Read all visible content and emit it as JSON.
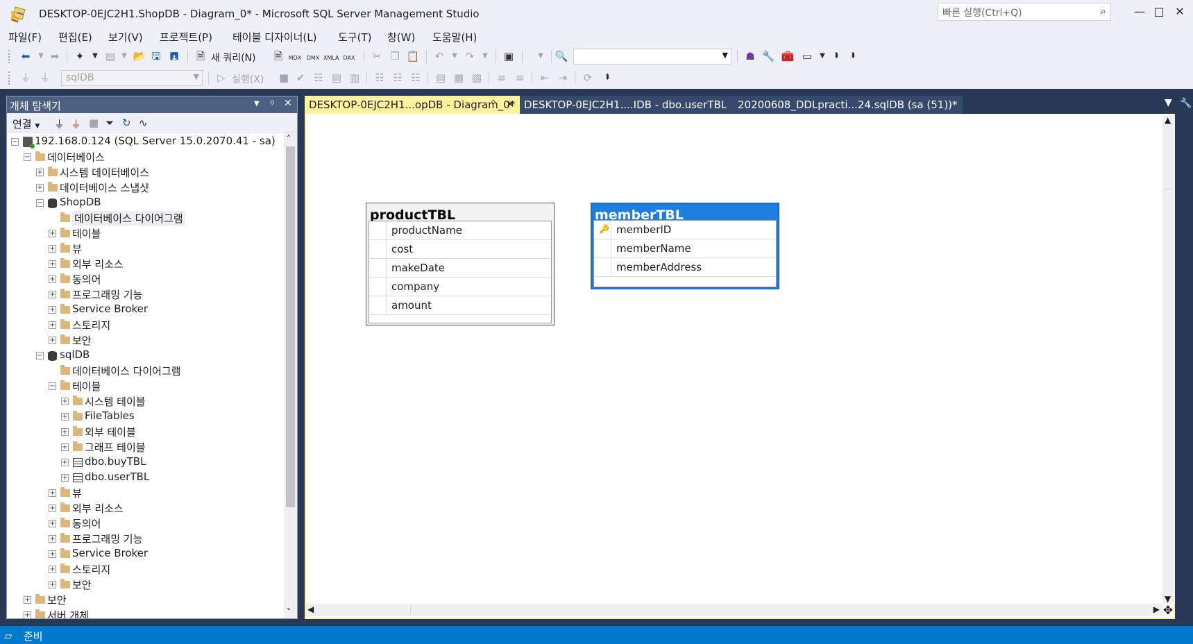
{
  "window": {
    "title": "DESKTOP-0EJC2H1.ShopDB - Diagram_0* - Microsoft SQL Server Management Studio",
    "quick_launch_placeholder": "빠른 실행(Ctrl+Q)",
    "minimize": "—",
    "maximize": "□",
    "close": "✕"
  },
  "menu": [
    "파일(F)",
    "편집(E)",
    "보기(V)",
    "프로젝트(P)",
    "테이블 디자이너(L)",
    "도구(T)",
    "창(W)",
    "도움말(H)"
  ],
  "toolbar1": {
    "new_query_label": "새 쿼리(N)",
    "query_types": [
      "MDX",
      "DMX",
      "XMLA",
      "DAX"
    ]
  },
  "toolbar2": {
    "database_combo": "sqlDB",
    "execute_label": "실행(X)"
  },
  "object_explorer": {
    "title": "개체 탐색기",
    "connect_label": "연결",
    "pin": "ᛜ",
    "close": "✕",
    "dropdown": "▼",
    "tree": [
      {
        "label": "192.168.0.124 (SQL Server 15.0.2070.41 - sa)",
        "icon": "server-icon",
        "level": 0,
        "expander": "−"
      },
      {
        "label": "데이터베이스",
        "icon": "folder-icon",
        "level": 1,
        "expander": "−"
      },
      {
        "label": "시스템 데이터베이스",
        "icon": "folder-icon",
        "level": 2,
        "expander": "+"
      },
      {
        "label": "데이터베이스 스냅샷",
        "icon": "folder-icon",
        "level": 2,
        "expander": "+"
      },
      {
        "label": "ShopDB",
        "icon": "database-icon",
        "level": 2,
        "expander": "−"
      },
      {
        "label": "데이터베이스 다이어그램",
        "icon": "folder-icon",
        "level": 3,
        "expander": "",
        "selected": true
      },
      {
        "label": "테이블",
        "icon": "folder-icon",
        "level": 3,
        "expander": "+"
      },
      {
        "label": "뷰",
        "icon": "folder-icon",
        "level": 3,
        "expander": "+"
      },
      {
        "label": "외부 리소스",
        "icon": "folder-icon",
        "level": 3,
        "expander": "+"
      },
      {
        "label": "동의어",
        "icon": "folder-icon",
        "level": 3,
        "expander": "+"
      },
      {
        "label": "프로그래밍 기능",
        "icon": "folder-icon",
        "level": 3,
        "expander": "+"
      },
      {
        "label": "Service Broker",
        "icon": "folder-icon",
        "level": 3,
        "expander": "+"
      },
      {
        "label": "스토리지",
        "icon": "folder-icon",
        "level": 3,
        "expander": "+"
      },
      {
        "label": "보안",
        "icon": "folder-icon",
        "level": 3,
        "expander": "+"
      },
      {
        "label": "sqlDB",
        "icon": "database-icon",
        "level": 2,
        "expander": "−"
      },
      {
        "label": "데이터베이스 다이어그램",
        "icon": "folder-icon",
        "level": 3,
        "expander": ""
      },
      {
        "label": "테이블",
        "icon": "folder-icon",
        "level": 3,
        "expander": "−"
      },
      {
        "label": "시스템 테이블",
        "icon": "folder-icon",
        "level": 4,
        "expander": "+"
      },
      {
        "label": "FileTables",
        "icon": "folder-icon",
        "level": 4,
        "expander": "+"
      },
      {
        "label": "외부 테이블",
        "icon": "folder-icon",
        "level": 4,
        "expander": "+"
      },
      {
        "label": "그래프 테이블",
        "icon": "folder-icon",
        "level": 4,
        "expander": "+"
      },
      {
        "label": "dbo.buyTBL",
        "icon": "table-icon",
        "level": 4,
        "expander": "+"
      },
      {
        "label": "dbo.userTBL",
        "icon": "table-icon",
        "level": 4,
        "expander": "+"
      },
      {
        "label": "뷰",
        "icon": "folder-icon",
        "level": 3,
        "expander": "+"
      },
      {
        "label": "외부 리소스",
        "icon": "folder-icon",
        "level": 3,
        "expander": "+"
      },
      {
        "label": "동의어",
        "icon": "folder-icon",
        "level": 3,
        "expander": "+"
      },
      {
        "label": "프로그래밍 기능",
        "icon": "folder-icon",
        "level": 3,
        "expander": "+"
      },
      {
        "label": "Service Broker",
        "icon": "folder-icon",
        "level": 3,
        "expander": "+"
      },
      {
        "label": "스토리지",
        "icon": "folder-icon",
        "level": 3,
        "expander": "+"
      },
      {
        "label": "보안",
        "icon": "folder-icon",
        "level": 3,
        "expander": "+"
      },
      {
        "label": "보안",
        "icon": "folder-icon",
        "level": 1,
        "expander": "+"
      },
      {
        "label": "서버 개체",
        "icon": "folder-icon",
        "level": 1,
        "expander": "+"
      }
    ]
  },
  "document_tabs": [
    {
      "label": "DESKTOP-0EJC2H1...opDB - Diagram_0*",
      "active": true,
      "pin": "ᛜ",
      "close": "✕"
    },
    {
      "label": "DESKTOP-0EJC2H1....IDB - dbo.userTBL",
      "active": false
    },
    {
      "label": "20200608_DDLpracti...24.sqlDB (sa (51))*",
      "active": false
    }
  ],
  "diagram": {
    "tables": [
      {
        "name": "productTBL",
        "selected": false,
        "columns": [
          {
            "name": "productName",
            "primary_key": false
          },
          {
            "name": "cost",
            "primary_key": false
          },
          {
            "name": "makeDate",
            "primary_key": false
          },
          {
            "name": "company",
            "primary_key": false
          },
          {
            "name": "amount",
            "primary_key": false
          }
        ]
      },
      {
        "name": "memberTBL",
        "selected": true,
        "columns": [
          {
            "name": "memberID",
            "primary_key": true
          },
          {
            "name": "memberName",
            "primary_key": false
          },
          {
            "name": "memberAddress",
            "primary_key": false
          }
        ]
      }
    ]
  },
  "status": {
    "text": "준비"
  },
  "colors": {
    "chrome": "#eef0f8",
    "frame": "#293955",
    "active_tab": "#fff29d",
    "selected_table": "#1e7fe0",
    "status_bar": "#007acc"
  }
}
